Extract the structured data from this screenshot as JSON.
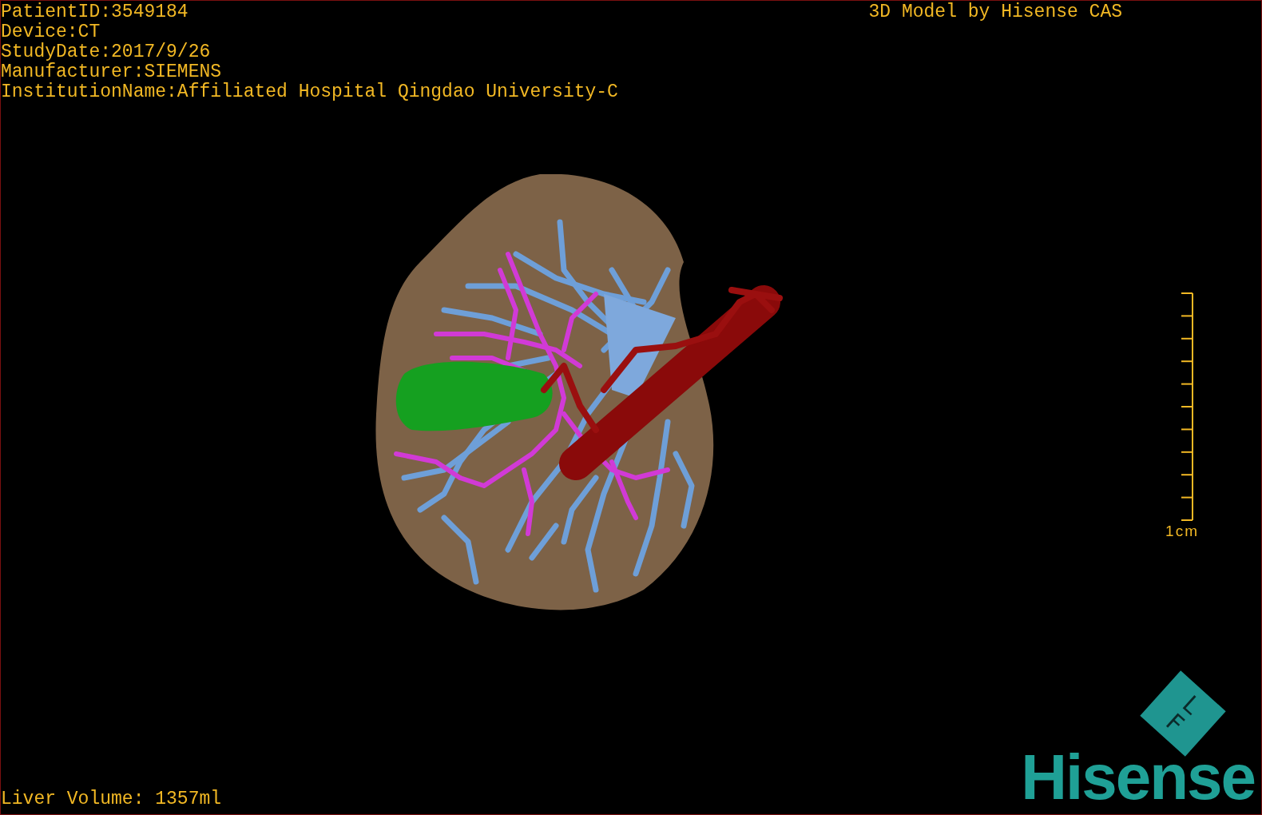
{
  "header": {
    "info_lines": [
      "PatientID:3549184",
      "Device:CT",
      "StudyDate:2017/9/26",
      "Manufacturer:SIEMENS",
      "InstitutionName:Affiliated Hospital Qingdao University-C"
    ],
    "title": "3D Model by Hisense CAS"
  },
  "scale_bar": {
    "label": "1cm"
  },
  "footer": {
    "volume": "Liver Volume: 1357ml"
  },
  "logo": {
    "cube_labels": [
      "F",
      "L"
    ],
    "wordmark": "Hisense"
  }
}
